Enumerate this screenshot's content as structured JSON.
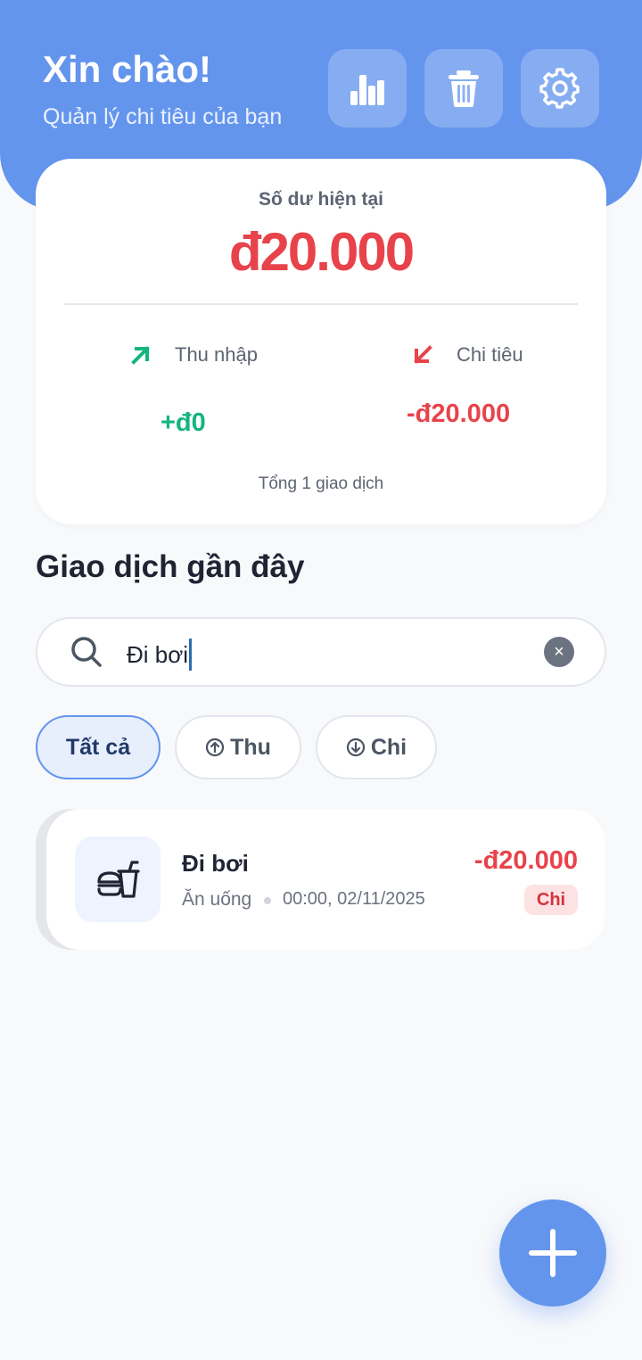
{
  "header": {
    "greeting": "Xin chào!",
    "subtitle": "Quản lý chi tiêu của bạn",
    "buttons": [
      {
        "icon": "bar-chart-icon"
      },
      {
        "icon": "trash-icon"
      },
      {
        "icon": "gear-icon"
      }
    ]
  },
  "summary": {
    "balance_label": "Số dư hiện tại",
    "balance_value": "đ20.000",
    "income_label": "Thu nhập",
    "income_value": "+đ0",
    "expense_label": "Chi tiêu",
    "expense_value": "-đ20.000",
    "total_text": "Tổng 1 giao dịch"
  },
  "recent": {
    "title": "Giao dịch gần đây"
  },
  "search": {
    "value": "Đi bơi",
    "clear_symbol": "×"
  },
  "filters": [
    {
      "label": "Tất cả",
      "active": true
    },
    {
      "label": "Thu",
      "icon": "arrow-up-circle-icon",
      "active": false
    },
    {
      "label": "Chi",
      "icon": "arrow-down-circle-icon",
      "active": false
    }
  ],
  "transactions": [
    {
      "title": "Đi bơi",
      "category": "Ăn uống",
      "datetime": "00:00, 02/11/2025",
      "amount": "-đ20.000",
      "type_label": "Chi",
      "icon": "fastfood-icon"
    }
  ],
  "colors": {
    "primary": "#6495ed",
    "income": "#14b57e",
    "expense": "#e8434b",
    "background": "#f8f9fb"
  }
}
